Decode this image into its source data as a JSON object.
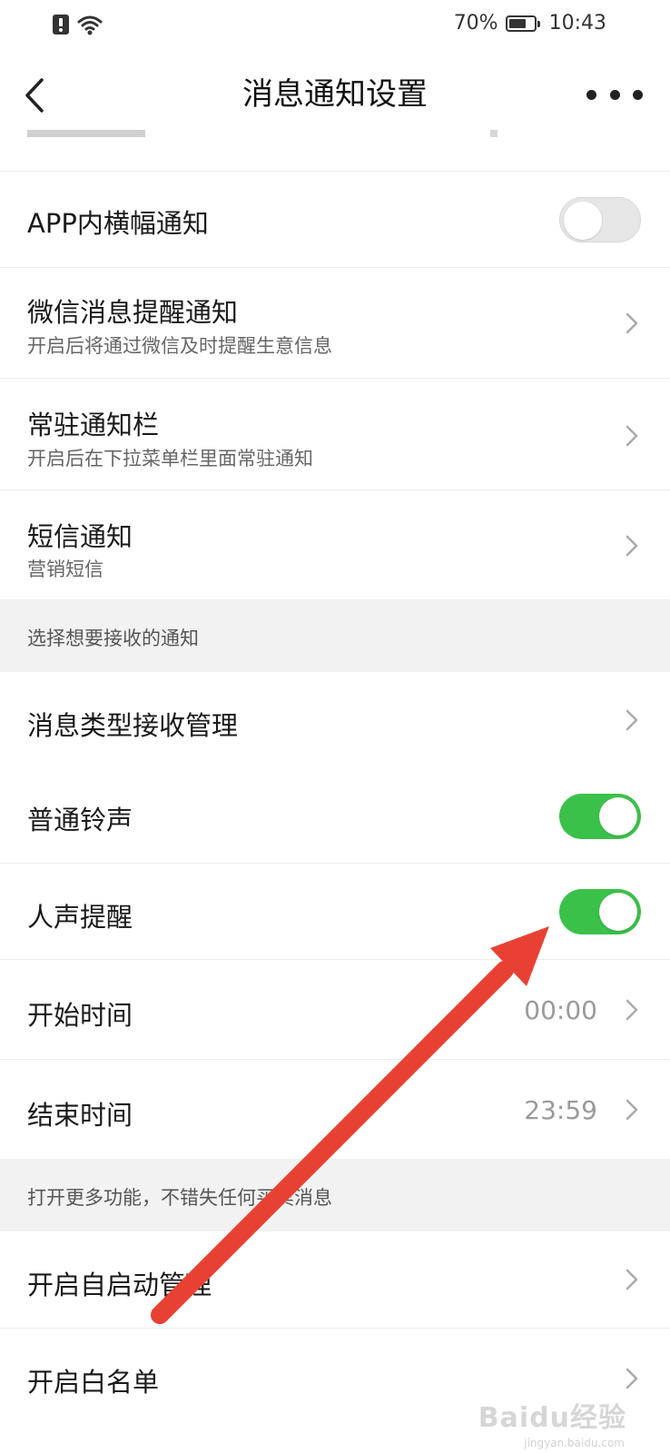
{
  "statusbar": {
    "battery": "70%",
    "battery_level": 0.7,
    "time": "10:43"
  },
  "header": {
    "title": "消息通知设置"
  },
  "rows": {
    "banner": {
      "label": "APP内横幅通知",
      "toggle_on": false
    },
    "wechat": {
      "label": "微信消息提醒通知",
      "sub": "开启后将通过微信及时提醒生意信息"
    },
    "resident": {
      "label": "常驻通知栏",
      "sub": "开启后在下拉菜单栏里面常驻通知"
    },
    "sms": {
      "label": "短信通知",
      "sub": "营销短信"
    },
    "msg_type": {
      "label": "消息类型接收管理"
    },
    "ringtone": {
      "label": "普通铃声",
      "toggle_on": true
    },
    "voice": {
      "label": "人声提醒",
      "toggle_on": true
    },
    "start": {
      "label": "开始时间",
      "value": "00:00"
    },
    "end": {
      "label": "结束时间",
      "value": "23:59"
    },
    "autostart": {
      "label": "开启自启动管理"
    },
    "whitelist": {
      "label": "开启白名单"
    }
  },
  "sections": {
    "choose": "选择想要接收的通知",
    "more": "打开更多功能，不错失任何买卖消息"
  },
  "colors": {
    "toggle_on": "#3ac14a",
    "toggle_off": "#e6e6e6",
    "annotation_arrow": "#e84133"
  },
  "watermark": {
    "text": "Baidu经验",
    "sub": "jingyan.baidu.com"
  }
}
